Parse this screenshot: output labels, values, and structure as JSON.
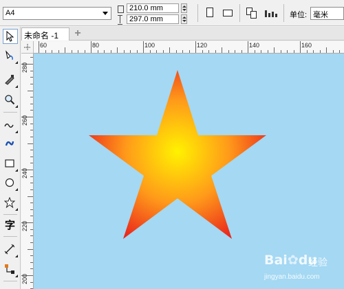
{
  "property_bar": {
    "paper_size": "A4",
    "width_value": "210.0 mm",
    "height_value": "297.0 mm",
    "unit_label": "单位:",
    "unit_value": "毫米"
  },
  "toolbox": {
    "text_tool_glyph": "字"
  },
  "document": {
    "tab_label": "未命名 -1",
    "add_tab_glyph": "+"
  },
  "ruler_h": {
    "labels": [
      "60",
      "80",
      "100",
      "120",
      "140",
      "160"
    ]
  },
  "ruler_v": {
    "labels": [
      "280",
      "260",
      "240",
      "220",
      "200"
    ]
  },
  "canvas": {
    "background": "#a4d8f3",
    "star": {
      "gradient_center": "#fff200",
      "gradient_mid": "#ff9a1a",
      "gradient_edge": "#e81c1c"
    }
  },
  "watermark": {
    "logo_text": "Bai",
    "logo_suffix": "du",
    "brand_cn": "经验",
    "url": "jingyan.baidu.com"
  }
}
